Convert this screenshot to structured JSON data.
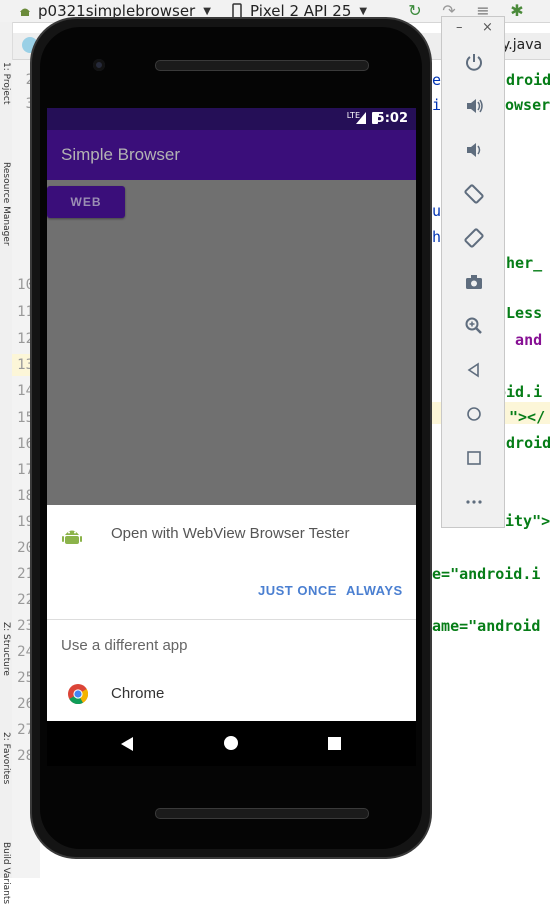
{
  "ide": {
    "project_name": "p0321simplebrowser",
    "device_name": "Pixel 2 API 25",
    "editor_tab_label": "y.java",
    "line_numbers": [
      "2",
      "3",
      "",
      "",
      "",
      "",
      "",
      "",
      "",
      "10",
      "11",
      "12",
      "13",
      "14",
      "15",
      "16",
      "17",
      "18",
      "19",
      "20",
      "21",
      "22",
      "23",
      "24",
      "25",
      "26",
      "27",
      "28"
    ],
    "side_tabs": [
      "1: Project",
      "Resource Manager",
      "Z: Structure",
      "2: Favorites",
      "Build Variants"
    ],
    "code_fragments": [
      {
        "text": "he",
        "kind": "kw"
      },
      {
        "text": "ndroid",
        "kind": "str"
      },
      {
        "text": "si",
        "kind": "kw"
      },
      {
        "text": "owser",
        "kind": "str"
      },
      {
        "text": "au",
        "kind": "kw"
      },
      {
        "text": "che",
        "kind": "kw"
      },
      {
        "text": "cher_",
        "kind": "str"
      },
      {
        "text": "e",
        "kind": "kw"
      },
      {
        "text": "dLess",
        "kind": "str"
      },
      {
        "text": "y",
        "kind": "kw"
      },
      {
        "text": "\" and",
        "kind": "attr"
      },
      {
        "text": "oid.i",
        "kind": "str"
      },
      {
        "text": "\"></",
        "kind": "str"
      },
      {
        "text": "ndroid",
        "kind": "str"
      },
      {
        "text": "ity\">",
        "kind": "str"
      },
      {
        "text": "me=\"android.i",
        "kind": "str"
      },
      {
        "text": "name=\"android",
        "kind": "str"
      }
    ]
  },
  "device": {
    "status_time": "5:02",
    "status_network": "LTE",
    "app_title": "Simple Browser",
    "web_button_label": "WEB",
    "chooser": {
      "open_with_text": "Open with WebView Browser Tester",
      "just_once_label": "JUST ONCE",
      "always_label": "ALWAYS",
      "different_app_label": "Use a different app",
      "other_app_name": "Chrome"
    }
  },
  "emulator_toolbar": {
    "buttons": [
      "power-icon",
      "volume-up-icon",
      "volume-down-icon",
      "rotate-left-icon",
      "rotate-right-icon",
      "camera-icon",
      "zoom-icon",
      "back-icon",
      "home-icon",
      "overview-icon",
      "more-icon"
    ]
  },
  "colors": {
    "app_bar": "#3a0e7a",
    "status_bar": "#250f57",
    "accent_button_text": "#4a7fd1"
  }
}
